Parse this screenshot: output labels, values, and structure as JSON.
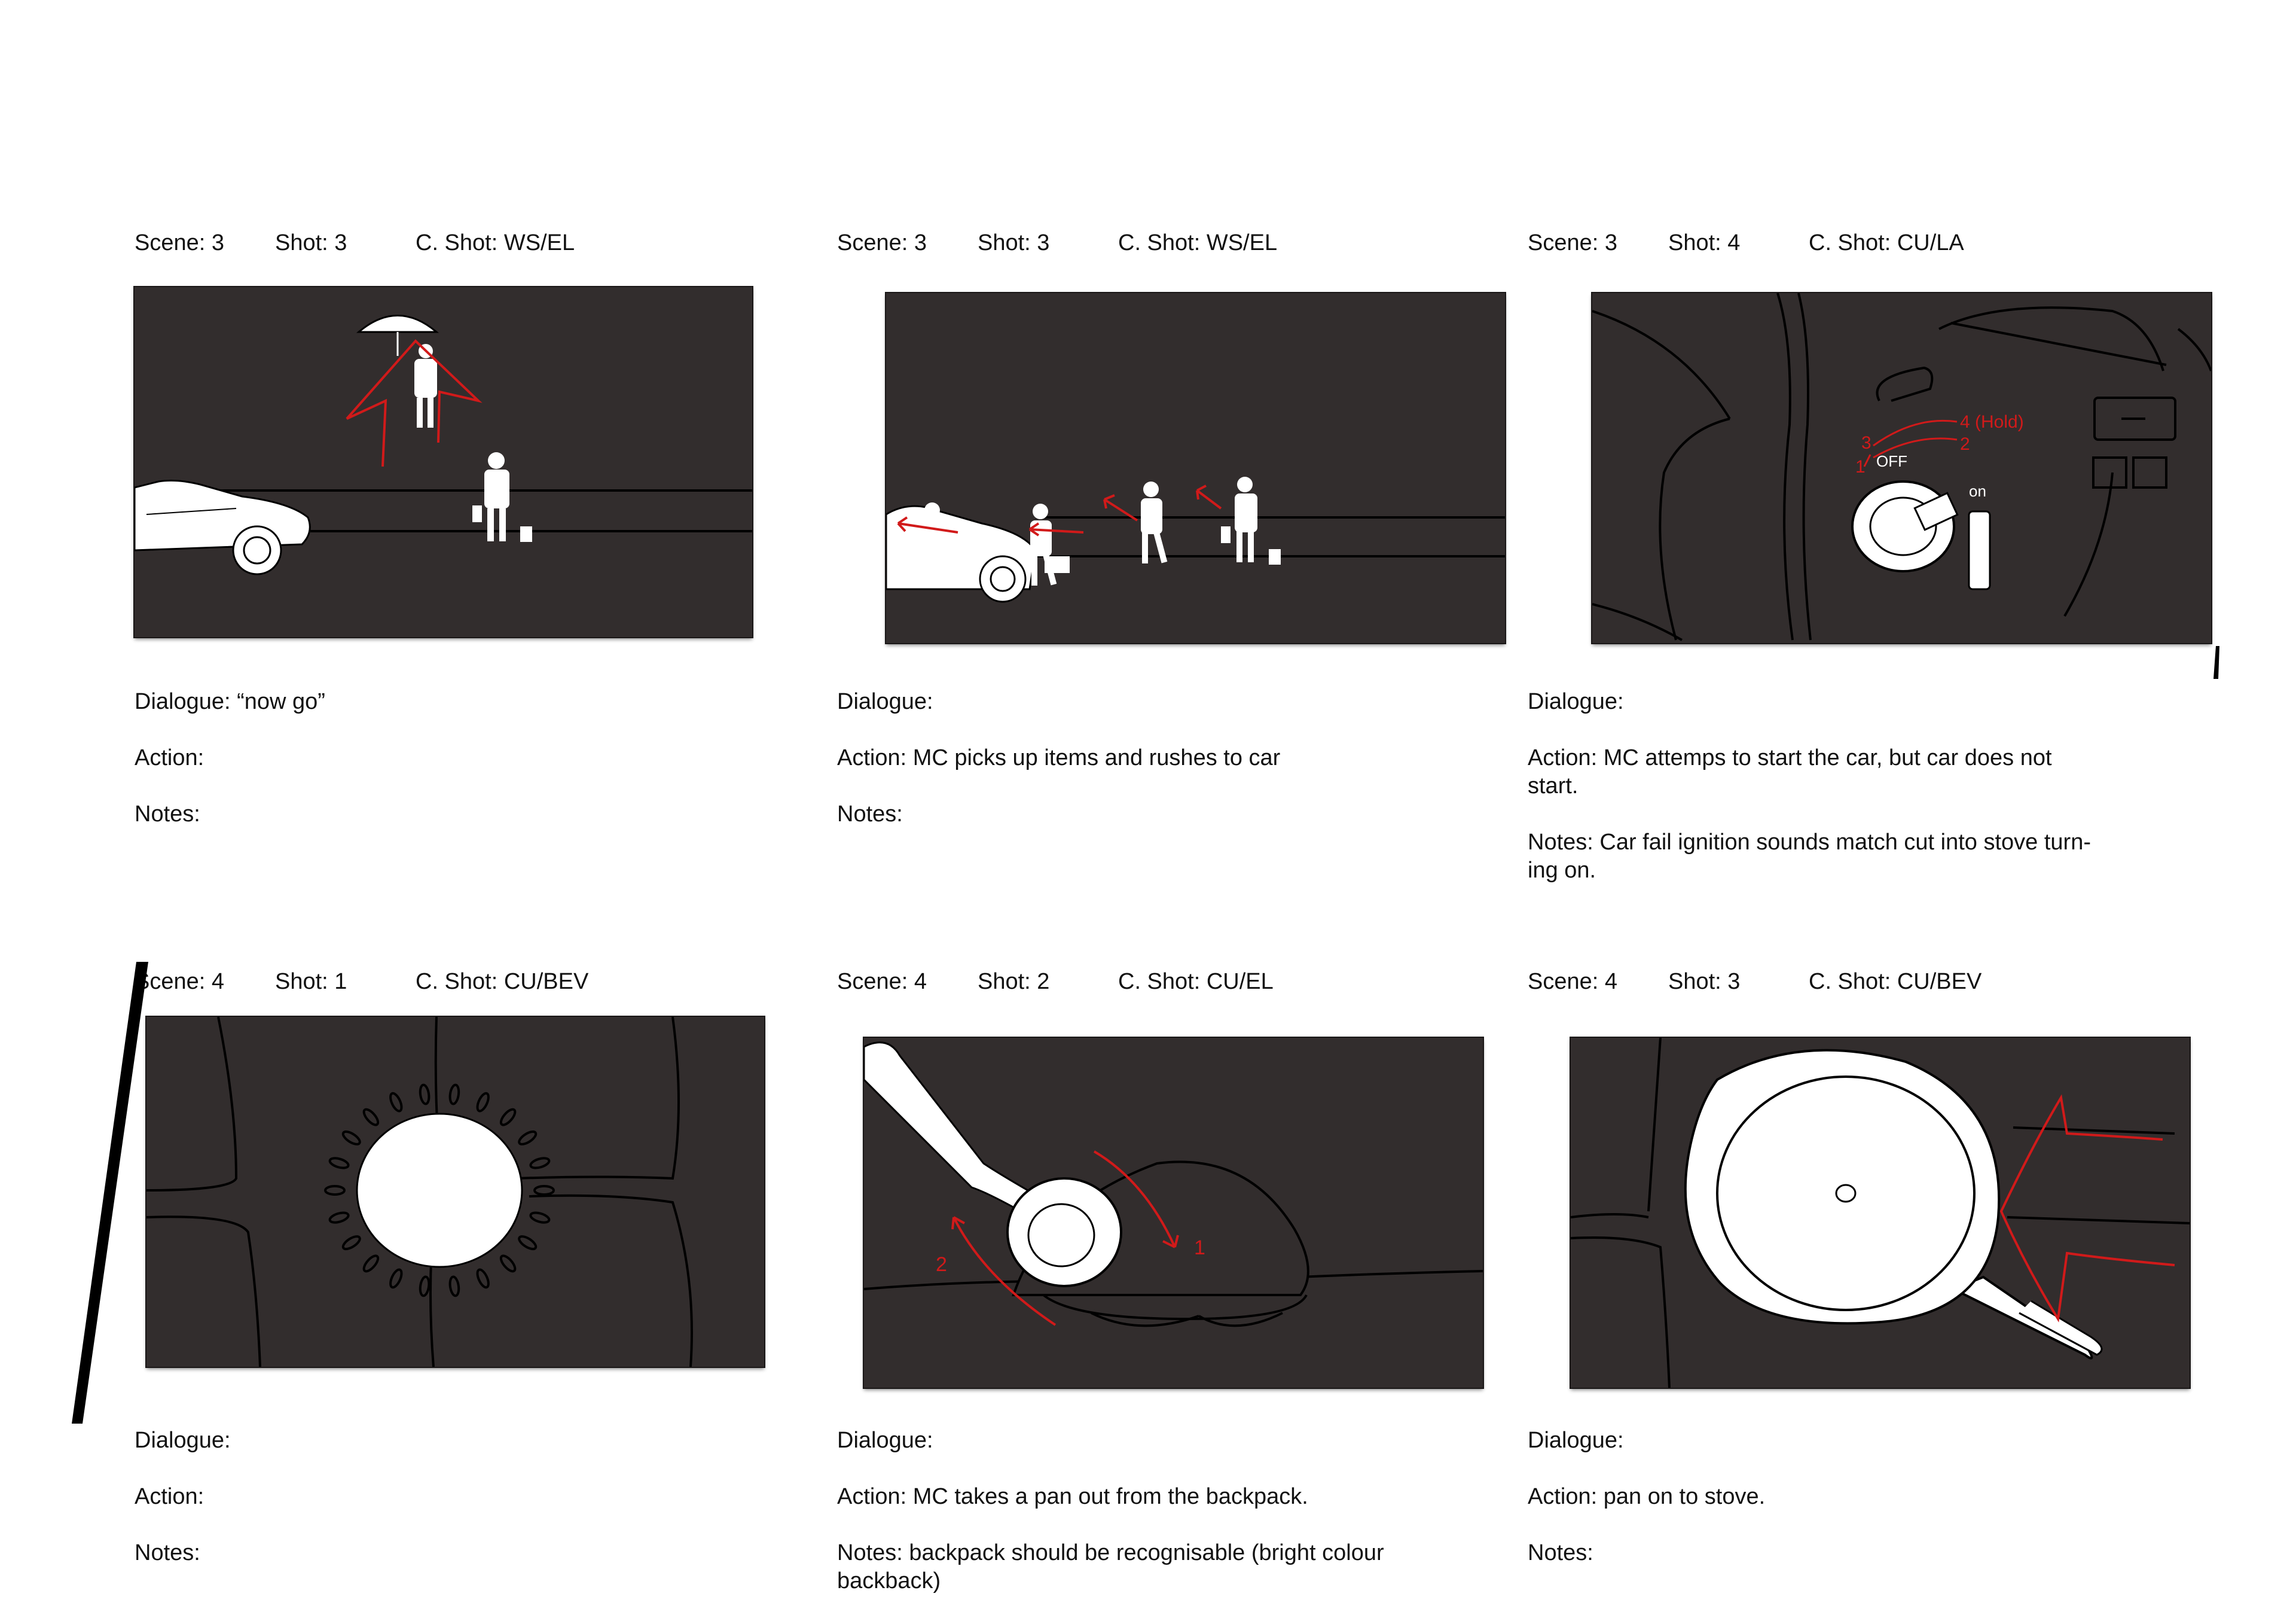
{
  "labels": {
    "scene": "Scene: ",
    "shot": "Shot: ",
    "camera": "C. Shot: "
  },
  "panels": [
    {
      "scene": "3",
      "shot": "3",
      "camera": "WS/EL",
      "dialogue": "Dialogue: “now go”",
      "action": "Action:",
      "notes": "Notes:"
    },
    {
      "scene": "3",
      "shot": "3",
      "camera": "WS/EL",
      "dialogue": "Dialogue:",
      "action": "Action: MC picks up items and rushes to car",
      "notes": "Notes:"
    },
    {
      "scene": "3",
      "shot": "4",
      "camera": "CU/LA",
      "dialogue": "Dialogue:",
      "action": "Action: MC attemps to start the car, but car does not\nstart.",
      "notes": "Notes: Car fail ignition sounds match cut into stove turn-\ning on.",
      "sketch_text": {
        "off": "OFF",
        "on": "on",
        "step3": "3",
        "step4": "4 (Hold)",
        "step2": "2",
        "step1": "1"
      }
    },
    {
      "scene": "4",
      "shot": "1",
      "camera": "CU/BEV",
      "dialogue": "Dialogue:",
      "action": "Action:",
      "notes": "Notes:"
    },
    {
      "scene": "4",
      "shot": "2",
      "camera": "CU/EL",
      "dialogue": "Dialogue:",
      "action": "Action: MC takes a pan out from the backpack.",
      "notes": "Notes: backpack should be recognisable (bright colour\nbackback)",
      "sketch_text": {
        "step1": "1",
        "step2": "2"
      }
    },
    {
      "scene": "4",
      "shot": "3",
      "camera": "CU/BEV",
      "dialogue": "Dialogue:",
      "action": "Action: pan on to stove.",
      "notes": "Notes:"
    }
  ],
  "colors": {
    "frame": "#322d2d",
    "sketch_red": "#d11a1a",
    "sketch_white": "#ffffff",
    "text": "#111111"
  }
}
